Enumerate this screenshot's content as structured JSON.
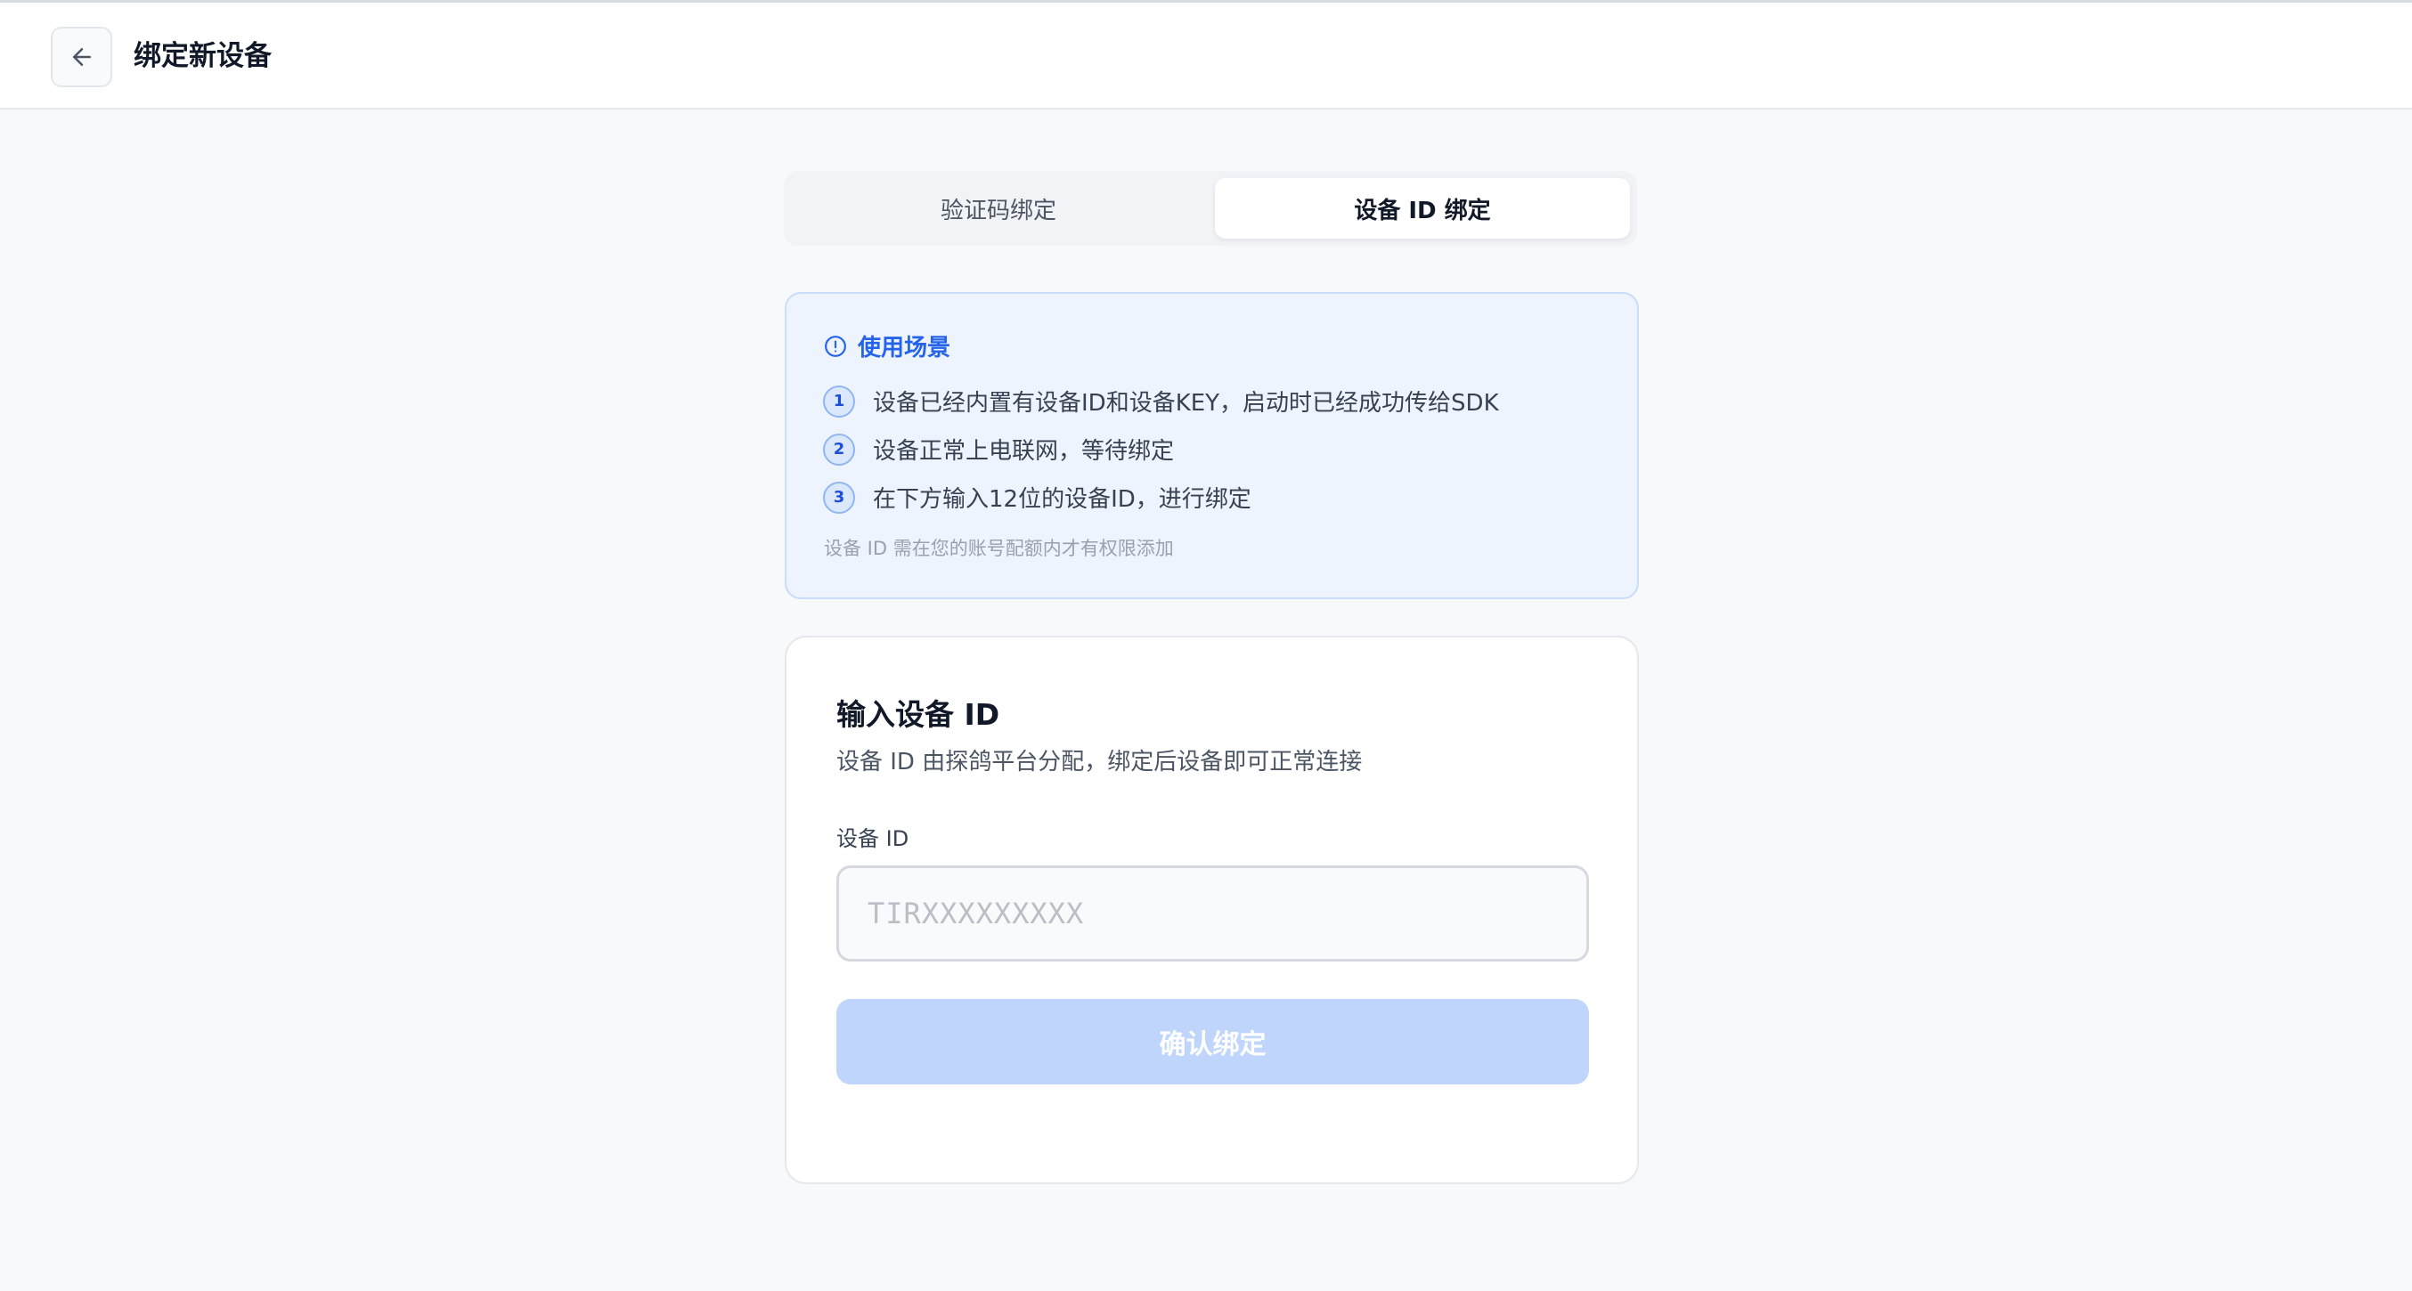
{
  "header": {
    "title": "绑定新设备"
  },
  "tabs": [
    {
      "label": "验证码绑定",
      "active": false
    },
    {
      "label": "设备 ID 绑定",
      "active": true
    }
  ],
  "info": {
    "title": "使用场景",
    "steps": [
      {
        "num": "1",
        "text": "设备已经内置有设备ID和设备KEY，启动时已经成功传给SDK"
      },
      {
        "num": "2",
        "text": "设备正常上电联网，等待绑定"
      },
      {
        "num": "3",
        "text": "在下方输入12位的设备ID，进行绑定"
      }
    ],
    "note": "设备 ID 需在您的账号配额内才有权限添加"
  },
  "form": {
    "title": "输入设备 ID",
    "subtitle": "设备 ID 由探鸽平台分配，绑定后设备即可正常连接",
    "field_label": "设备 ID",
    "placeholder": "TIRXXXXXXXXX",
    "value": "",
    "confirm_label": "确认绑定"
  },
  "colors": {
    "accent": "#2563eb",
    "button_disabled": "#bfd5fb",
    "info_bg": "#eef4fe"
  },
  "icons": {
    "back": "arrow-left-icon",
    "info": "info-circle-icon"
  }
}
